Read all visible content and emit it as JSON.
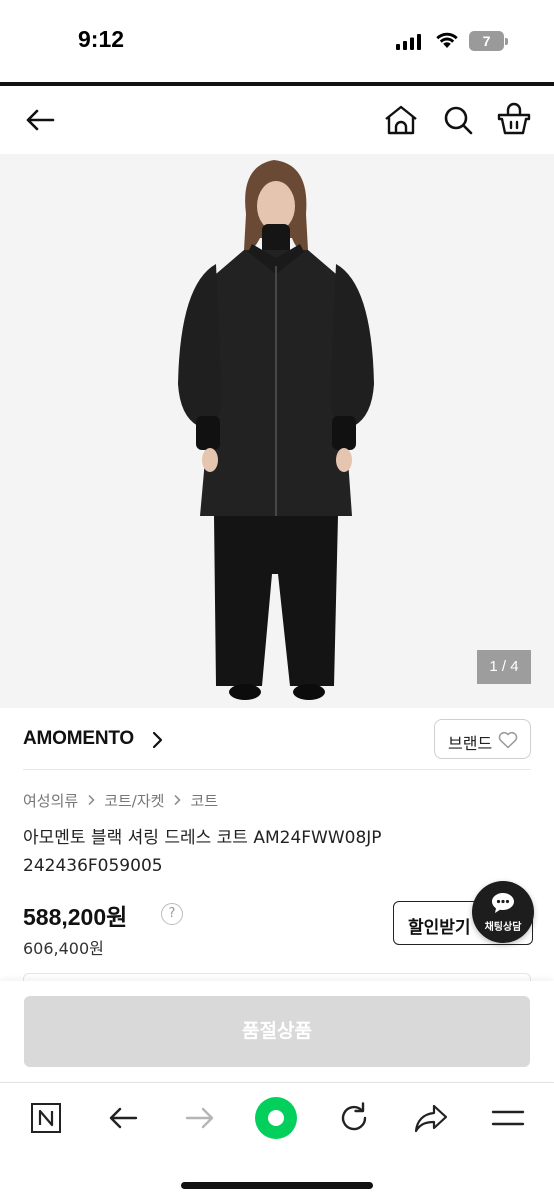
{
  "status_bar": {
    "time": "9:12",
    "battery_level": "7",
    "icons": [
      "cellular-signal-icon",
      "wifi-icon",
      "battery-icon"
    ]
  },
  "nav": {
    "icons": [
      "back-arrow-icon",
      "home-icon",
      "search-icon",
      "cart-icon"
    ]
  },
  "gallery": {
    "counter": "1 / 4",
    "background_color": "#f4f4f4"
  },
  "brand": {
    "name": "AMOMENTO",
    "button_label": "브랜드",
    "icons": [
      "chevron-right-icon",
      "heart-icon"
    ]
  },
  "breadcrumb": [
    "여성의류",
    "코트/자켓",
    "코트"
  ],
  "product": {
    "title": "아모멘토 블랙 셔링 드레스 코트 AM24FWW08JP 242436F059005",
    "price": "588,200원",
    "original_price": "606,400원",
    "help_symbol": "?",
    "coupon_label": "할인받기",
    "chat_label": "채팅상담"
  },
  "purchase": {
    "button_label": "품절상품",
    "button_color": "#d9d9d9"
  },
  "browser_bar": {
    "icons": [
      "naver-n-icon",
      "back-arrow-icon",
      "forward-arrow-icon",
      "green-dot-icon",
      "reload-icon",
      "share-icon",
      "menu-icon"
    ],
    "accent_color": "#03cf5d"
  }
}
